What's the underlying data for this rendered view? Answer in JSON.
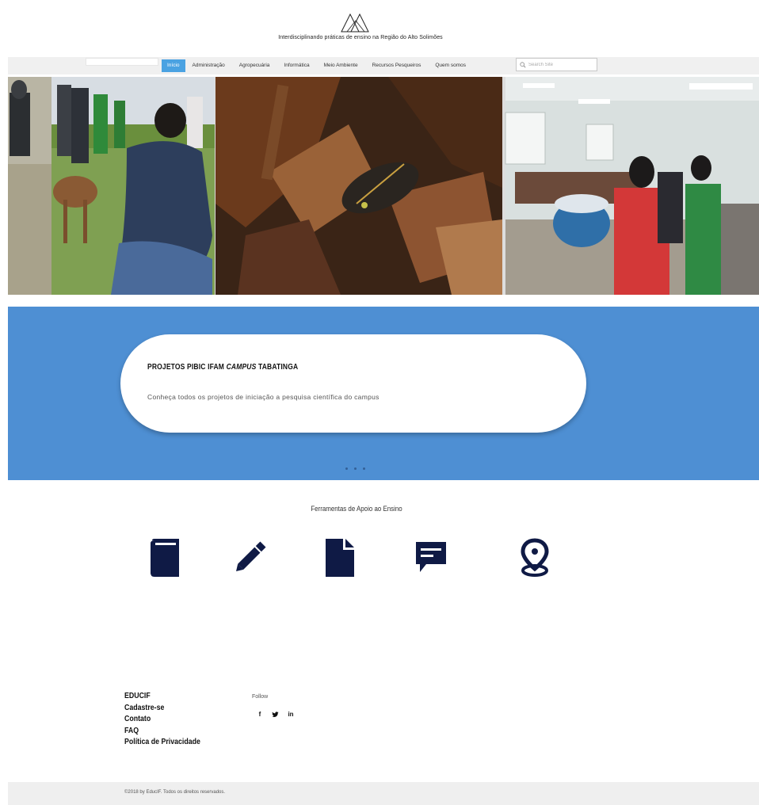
{
  "header": {
    "tagline": "Interdisciplinando práticas de ensino na Região do Alto Solimões"
  },
  "nav": {
    "items": [
      {
        "label": "Início",
        "active": true
      },
      {
        "label": "Administração",
        "active": false
      },
      {
        "label": "Agropecuária",
        "active": false
      },
      {
        "label": "Informática",
        "active": false
      },
      {
        "label": "Meio Ambiente",
        "active": false
      },
      {
        "label": "Recursos Pesqueiros",
        "active": false
      },
      {
        "label": "Quem somos",
        "active": false
      }
    ],
    "search_placeholder": "Search Site"
  },
  "banner": {
    "title_prefix": "PROJETOS PIBIC IFAM ",
    "title_italic": "CAMPUS",
    "title_suffix": " TABATINGA",
    "description": "Conheça todos os projetos de iniciação a pesquisa científica do campus",
    "slide_count": 3
  },
  "tools": {
    "title": "Ferramentas de Apoio ao Ensino",
    "icons": [
      "book-icon",
      "pencil-icon",
      "document-icon",
      "chat-icon",
      "map-pin-icon"
    ]
  },
  "footer": {
    "links": [
      "EDUCIF",
      "Cadastre-se",
      "Contato",
      "FAQ",
      "Política de Privacidade"
    ],
    "follow_label": "Follow",
    "socials": [
      {
        "icon": "facebook-icon",
        "glyph": "f"
      },
      {
        "icon": "twitter-icon",
        "glyph": "🐦"
      },
      {
        "icon": "linkedin-icon",
        "glyph": "in"
      }
    ],
    "copyright": "©2018 by EducIF. Todos os direitos reservados."
  },
  "colors": {
    "accent": "#4aa2e2",
    "banner": "#4e8fd3",
    "icon": "#0f1a45"
  }
}
